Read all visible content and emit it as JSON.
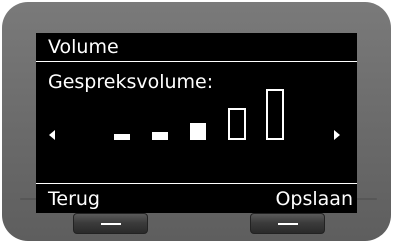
{
  "screen": {
    "title": "Volume",
    "setting_label": "Gespreksvolume:"
  },
  "volume": {
    "level": 3,
    "max_level": 5,
    "left_arrow_icon": "triangle-left-icon",
    "right_arrow_icon": "triangle-right-icon"
  },
  "softkeys": {
    "left_label": "Terug",
    "right_label": "Opslaan"
  },
  "colors": {
    "display_background": "#000000",
    "display_text": "#ffffff",
    "device_body": "#6e6e6e",
    "hardware_key": "#333333"
  }
}
